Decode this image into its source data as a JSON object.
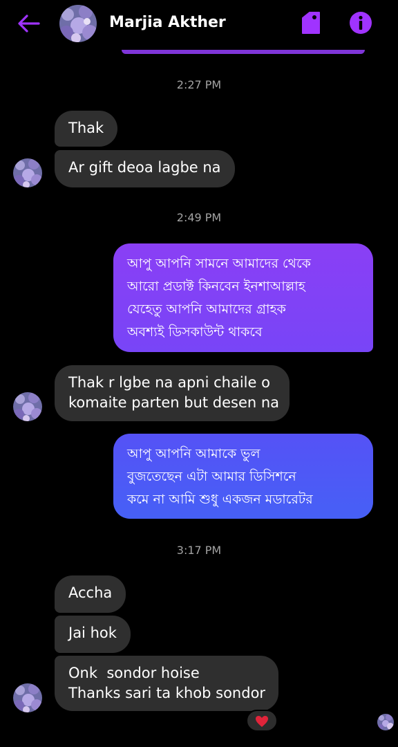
{
  "header": {
    "contact_name": "Marjia Akther",
    "back_icon": "arrow-left-icon",
    "tag_icon": "tag-icon",
    "info_icon": "info-icon",
    "accent_color": "#a033ff"
  },
  "timestamps": [
    "2:27 PM",
    "2:49 PM",
    "3:17 PM"
  ],
  "messages": [
    {
      "text": "Thak"
    },
    {
      "text": "Ar gift deoa lagbe na"
    },
    {
      "text": "আপু আপনি সামনে আমাদের থেকে\nআরো প্রডাক্ট কিনবেন ইনশাআল্লাহ\nযেহেতু আপনি আমাদের গ্রাহক\nঅবশ্যই ডিসকাউন্ট থাকবে"
    },
    {
      "text": "Thak r lgbe na apni chaile o\nkomaite parten but desen na"
    },
    {
      "text": "আপু আপনি আমাকে ভুল\nবুজতেছেন এটা আমার ডিসিশনে\nকমে না আমি শুধু একজন মডারেটর"
    },
    {
      "text": "Accha"
    },
    {
      "text": "Jai hok"
    },
    {
      "text": "Onk  sondor hoise\nThanks sari ta khob sondor"
    }
  ],
  "reaction": {
    "emoji": "❤️",
    "color": "#e0243a"
  },
  "colors": {
    "incoming_bubble": "#2f2f2f",
    "outgoing_purple": "#7d3ff7",
    "outgoing_blue": "#4a5cf6",
    "timestamp": "#a3a3a3"
  }
}
